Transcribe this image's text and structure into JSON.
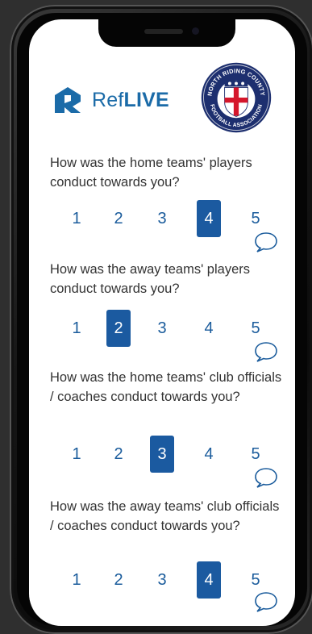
{
  "app": {
    "brand_prefix": "Ref",
    "brand_suffix": "LIVE"
  },
  "badge": {
    "text_top": "NORTH RIDING COUNTY",
    "text_bottom": "FOOTBALL ASSOCIATION"
  },
  "questions": [
    {
      "text": "How was the home teams' players conduct towards you?",
      "selected": 4
    },
    {
      "text": "How was the away teams' players conduct towards you?",
      "selected": 2
    },
    {
      "text": "How was the home teams' club officials / coaches conduct towards you?",
      "selected": 3
    },
    {
      "text": "How was the away teams' club officials / coaches conduct towards you?",
      "selected": 4
    }
  ],
  "ratings": [
    "1",
    "2",
    "3",
    "4",
    "5"
  ],
  "colors": {
    "accent": "#1b5aa0",
    "brand": "#1b6ba8",
    "badge_navy": "#1d2f6f",
    "cross_red": "#d5162b"
  },
  "icons": {
    "comment": "speech-bubble-icon"
  }
}
